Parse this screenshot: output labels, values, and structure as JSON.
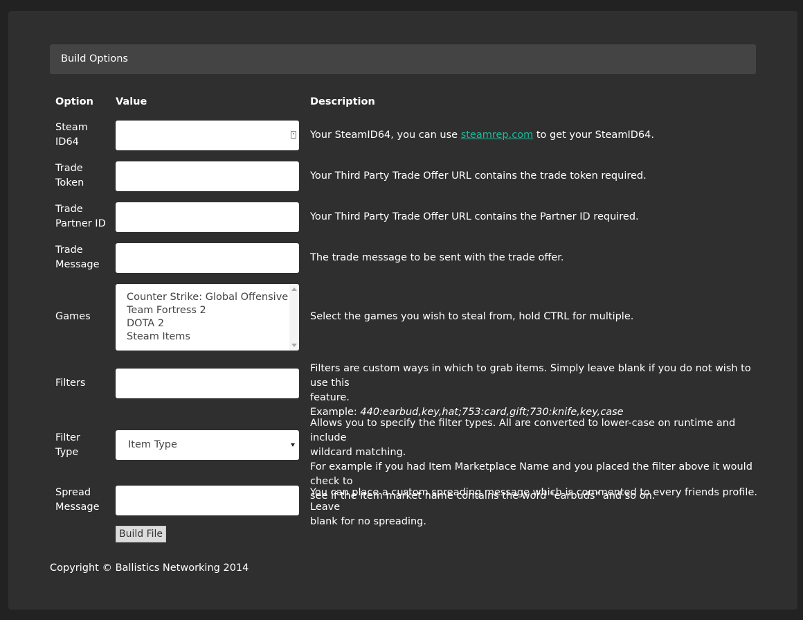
{
  "panel": {
    "heading": "Build Options"
  },
  "table_headers": {
    "option": "Option",
    "value": "Value",
    "description": "Description"
  },
  "rows": {
    "steam_id": {
      "label_line1": "Steam",
      "label_line2": "ID64",
      "value": "",
      "desc_before": "Your SteamID64, you can use ",
      "desc_link": "steamrep.com",
      "desc_after": " to get your SteamID64."
    },
    "trade_token": {
      "label_line1": "Trade",
      "label_line2": "Token",
      "value": "",
      "desc": "Your Third Party Trade Offer URL contains the trade token required."
    },
    "trade_partner": {
      "label_line1": "Trade",
      "label_line2": "Partner ID",
      "value": "",
      "desc": "Your Third Party Trade Offer URL contains the Partner ID required."
    },
    "trade_message": {
      "label_line1": "Trade",
      "label_line2": "Message",
      "value": "",
      "desc": "The trade message to be sent with the trade offer."
    },
    "games": {
      "label": "Games",
      "options": [
        "Counter Strike: Global Offensive",
        "Team Fortress 2",
        "DOTA 2",
        "Steam Items"
      ],
      "desc": "Select the games you wish to steal from, hold CTRL for multiple."
    },
    "filters": {
      "label": "Filters",
      "value": "",
      "desc_line1": "Filters are custom ways in which to grab items. Simply leave blank if you do not wish to use this",
      "desc_line2": "feature.",
      "example_prefix": "Example: ",
      "example_value": "440:earbud,key,hat;753:card,gift;730:knife,key,case"
    },
    "filter_type": {
      "label_line1": "Filter",
      "label_line2": "Type",
      "selected": "Item Type",
      "desc_line1": "Allows you to specify the filter types. All are converted to lower-case on runtime and include",
      "desc_line2": "wildcard matching.",
      "desc_line3": "For example if you had Item Marketplace Name and you placed the filter above it would check to",
      "desc_line4": "see if the item market name contains the word \"earbuds\" and so on."
    },
    "spread_message": {
      "label_line1": "Spread",
      "label_line2": "Message",
      "value": "",
      "desc_line1": "You can place a custom spreading message which is commented to every friends profile. Leave",
      "desc_line2": "blank for no spreading."
    }
  },
  "build_button": "Build File",
  "footer": "Copyright © Ballistics Networking 2014",
  "colors": {
    "link": "#1abc9c",
    "panel_bg": "#2f2f2f",
    "heading_bg": "#444444"
  }
}
